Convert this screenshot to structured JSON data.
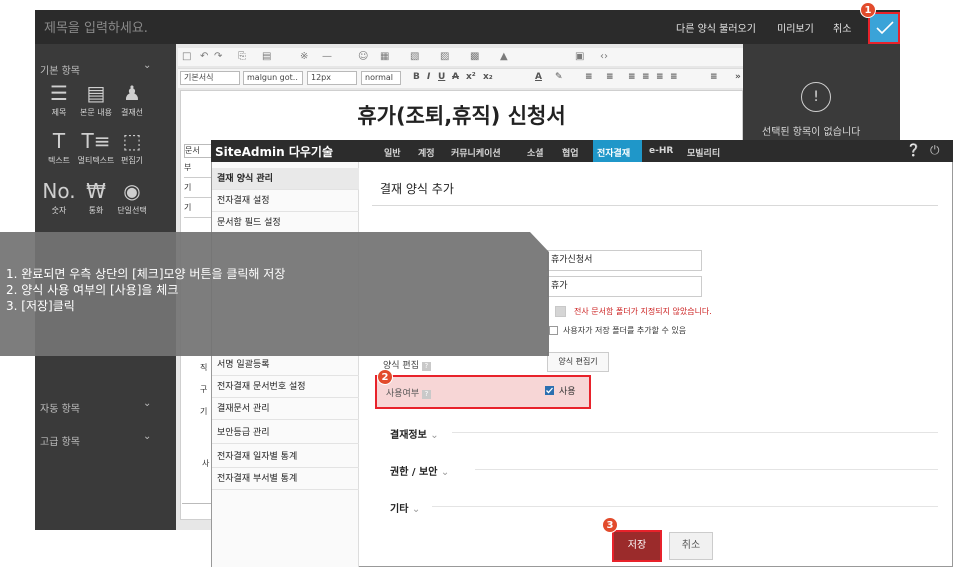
{
  "editor": {
    "title_placeholder": "제목을 입력하세요.",
    "top_links": [
      "다른 양식 불러오기",
      "미리보기",
      "취소"
    ],
    "check_icon": "check-icon",
    "left_panel": {
      "basic_section": "기본 항목",
      "basic_items": [
        {
          "label": "제목",
          "icon": "title-icon"
        },
        {
          "label": "본문 내용",
          "icon": "content-icon"
        },
        {
          "label": "결재선",
          "icon": "approver-icon"
        },
        {
          "label": "텍스트",
          "icon": "text-icon"
        },
        {
          "label": "멀티텍스트",
          "icon": "multitext-icon"
        },
        {
          "label": "편집기",
          "icon": "editor-icon"
        },
        {
          "label": "숫자",
          "icon": "number-icon"
        },
        {
          "label": "통화",
          "icon": "currency-icon"
        },
        {
          "label": "단일선택",
          "icon": "radio-icon"
        }
      ],
      "auto_section": "자동 항목",
      "advanced_section": "고급 항목"
    },
    "toolbar_selects": [
      "기본서식",
      "malgun got..",
      "12px",
      "normal"
    ],
    "doc_title": "휴가(조퇴,휴직) 신청서",
    "doc_row_labels": [
      "문서",
      "부",
      "기",
      "기",
      "직",
      "구",
      "기",
      "사"
    ],
    "no_selection_text": "선택된 항목이 없습니다"
  },
  "siteadmin": {
    "brand": "SiteAdmin 다우기술",
    "menu": [
      "일반",
      "계정",
      "커뮤니케이션",
      "소셜",
      "협업",
      "전자결재",
      "e-HR",
      "모빌리티"
    ],
    "active_menu": "전자결재",
    "sidebar": [
      "결재 양식 관리",
      "전자결재 설정",
      "문서함 필드 설정",
      "서명 일괄등록",
      "전자결재 문서번호 설정",
      "결재문서 관리",
      "보안등급 관리",
      "전자결재 일자별 통계",
      "전자결재 부서별 통계"
    ],
    "page_title": "결재 양식 추가",
    "basic_section_label": "기본",
    "form_name": "휴가신청서",
    "form_alias": "휴가",
    "warning": "전사 문서함 폴더가 지정되지 않았습니다.",
    "user_folder_option": "사용자가 저장 폴더를 추가할 수 있음",
    "form_edit_label": "양식 편집",
    "form_editor_button": "양식 편집기",
    "usage_label": "사용여부",
    "usage_option": "사용",
    "usage_checked": true,
    "sections": [
      "결재정보",
      "권한 / 보안",
      "기타"
    ],
    "save_button": "저장",
    "cancel_button": "취소"
  },
  "callout": {
    "lines": [
      "1.  완료되면 우측 상단의 [체크]모양 버튼을 클릭해 저장",
      "2.  양식 사용 여부의 [사용]을 체크",
      "3.  [저장]클릭"
    ]
  },
  "badges": [
    "1",
    "2",
    "3"
  ],
  "colors": {
    "highlight_red": "#e8222b",
    "accent_blue": "#1f97c9",
    "check_button": "#3aa3d8",
    "save_button": "#9b2b2b"
  }
}
